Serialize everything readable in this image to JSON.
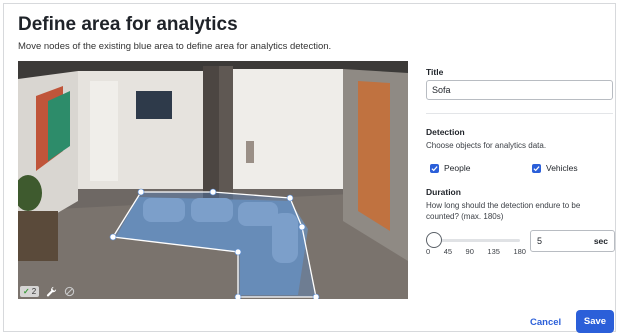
{
  "dialog": {
    "title": "Define area for analytics",
    "subtitle": "Move nodes of the existing blue area to define area for analytics detection."
  },
  "camera": {
    "toolbar": {
      "check_count": "2"
    }
  },
  "form": {
    "title_label": "Title",
    "title_value": "Sofa",
    "detection_label": "Detection",
    "detection_help": "Choose objects for analytics data.",
    "people_label": "People",
    "people_checked": true,
    "vehicles_label": "Vehicles",
    "vehicles_checked": true,
    "duration_label": "Duration",
    "duration_help": "How long should the detection endure to be counted? (max. 180s)",
    "slider_ticks": [
      "0",
      "45",
      "90",
      "135",
      "180"
    ],
    "slider_value": 0,
    "duration_value": "5",
    "duration_unit": "sec"
  },
  "footer": {
    "cancel_label": "Cancel",
    "save_label": "Save"
  },
  "colors": {
    "accent": "#2b5fd9"
  }
}
